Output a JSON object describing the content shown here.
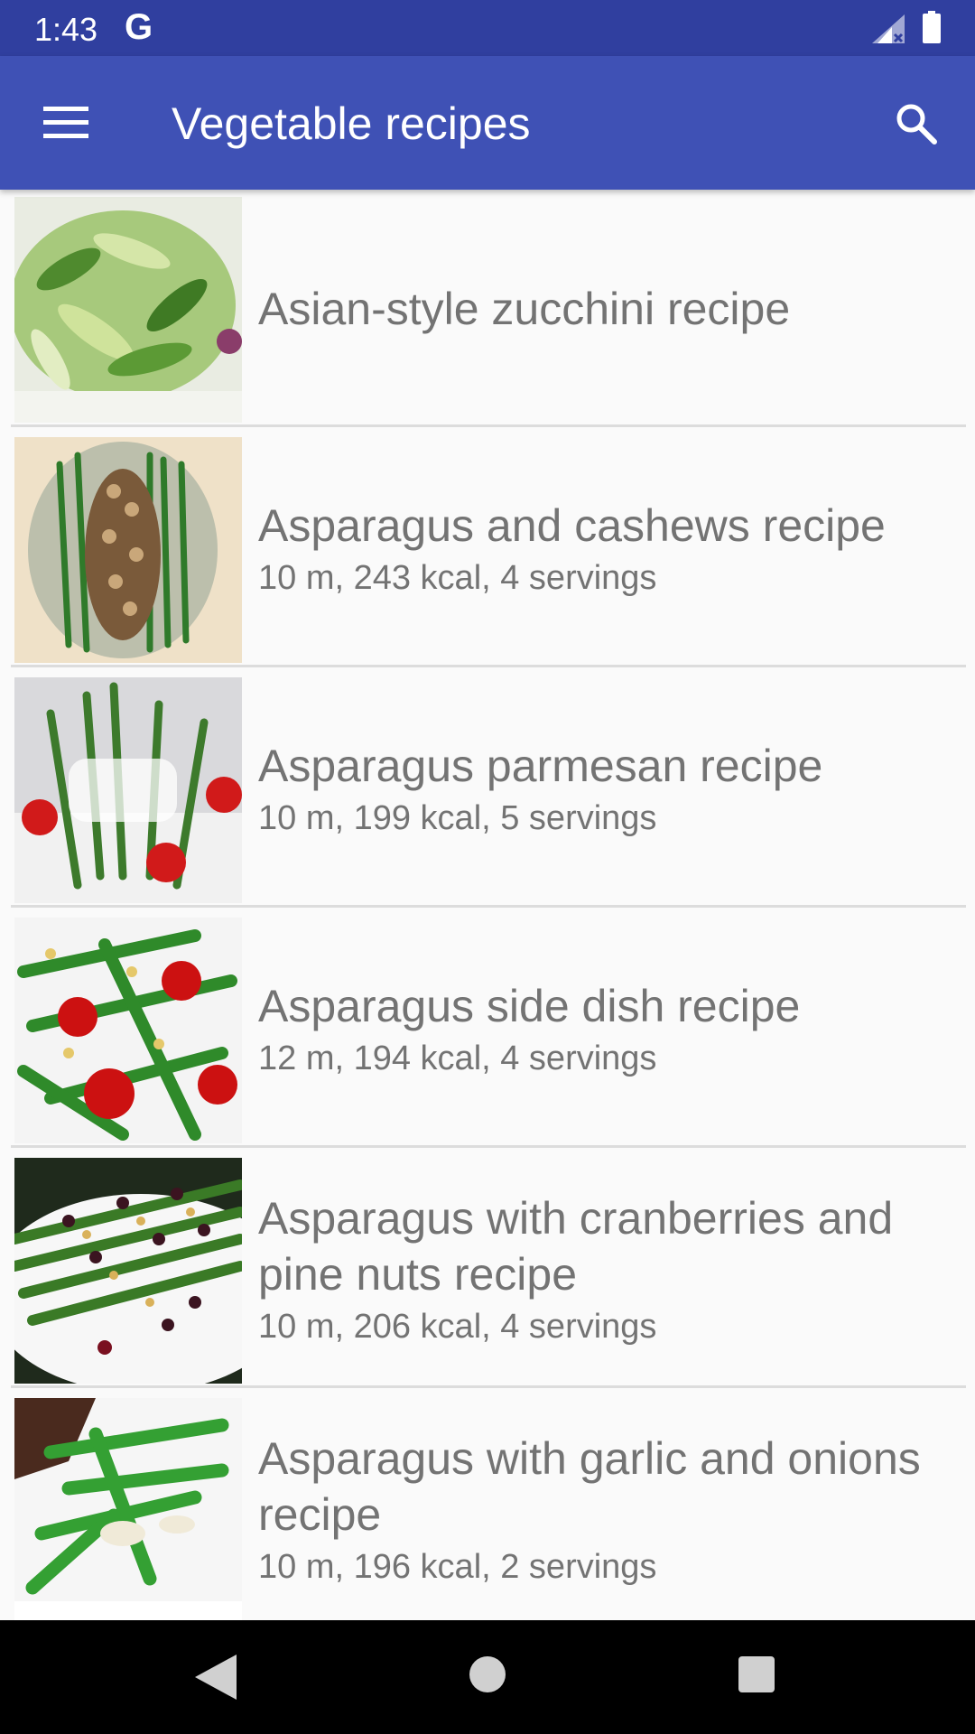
{
  "status_bar": {
    "time": "1:43",
    "g_label": "G",
    "icons": [
      "signal-icon",
      "battery-icon"
    ]
  },
  "app_bar": {
    "title": "Vegetable recipes",
    "icons": [
      "menu-icon",
      "search-icon"
    ],
    "color": "#3f51b5",
    "status_color": "#303f9f"
  },
  "recipes": [
    {
      "title": "Asian-style zucchini recipe",
      "meta": ""
    },
    {
      "title": "Asparagus and cashews recipe",
      "meta": "10 m, 243 kcal, 4 servings"
    },
    {
      "title": "Asparagus parmesan recipe",
      "meta": "10 m, 199 kcal, 5 servings"
    },
    {
      "title": "Asparagus side dish recipe",
      "meta": "12 m, 194 kcal, 4 servings"
    },
    {
      "title": "Asparagus with cranberries and pine nuts recipe",
      "meta": "10 m, 206 kcal, 4 servings"
    },
    {
      "title": "Asparagus with garlic and onions recipe",
      "meta": "10 m, 196 kcal, 2 servings"
    }
  ],
  "nav_bar": {
    "icons": [
      "back-icon",
      "home-icon",
      "recents-icon"
    ]
  }
}
